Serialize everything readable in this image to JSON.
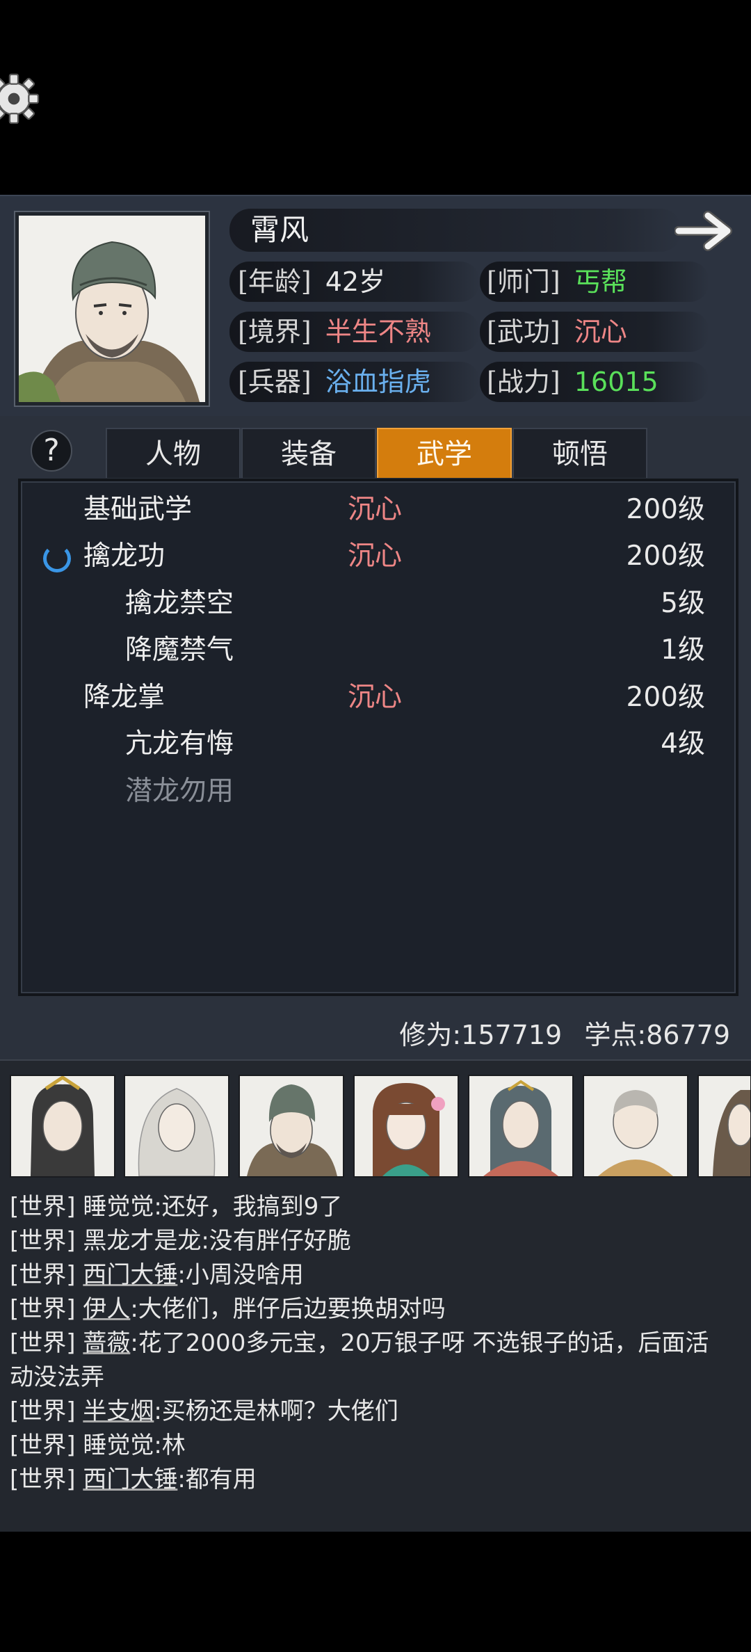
{
  "profile": {
    "name": "霄风",
    "age_label": "[年龄]",
    "age": "42岁",
    "sect_label": "[师门]",
    "sect": "丐帮",
    "realm_label": "[境界]",
    "realm": "半生不熟",
    "martial_label": "[武功]",
    "martial": "沉心",
    "weapon_label": "[兵器]",
    "weapon": "浴血指虎",
    "power_label": "[战力]",
    "power": "16015"
  },
  "help": "?",
  "tabs": [
    {
      "label": "人物",
      "active": false
    },
    {
      "label": "装备",
      "active": false
    },
    {
      "label": "武学",
      "active": true
    },
    {
      "label": "顿悟",
      "active": false
    }
  ],
  "skills": [
    {
      "name": "基础武学",
      "state": "沉心",
      "level": "200级"
    },
    {
      "name": "擒龙功",
      "state": "沉心",
      "level": "200级"
    },
    {
      "name": "擒龙禁空",
      "state": "",
      "level": "5级"
    },
    {
      "name": "降魔禁气",
      "state": "",
      "level": "1级"
    },
    {
      "name": "降龙掌",
      "state": "沉心",
      "level": "200级"
    },
    {
      "name": "亢龙有悔",
      "state": "",
      "level": "4级"
    },
    {
      "name": "潜龙勿用",
      "state": "",
      "level": ""
    }
  ],
  "footer": {
    "cultivation": "修为:157719",
    "points": "学点:86779"
  },
  "chat": [
    {
      "channel": "[世界]",
      "user": "睡觉觉",
      "text": ":还好，我搞到9了"
    },
    {
      "channel": "[世界]",
      "user": "黑龙才是龙",
      "text": ":没有胖仔好脆"
    },
    {
      "channel": "[世界]",
      "user": "西门大锤",
      "text": ":小周没啥用"
    },
    {
      "channel": "[世界]",
      "user": "伊人",
      "text": ":大佬们，胖仔后边要换胡对吗"
    },
    {
      "channel": "[世界]",
      "user": "蔷薇",
      "text": ":花了2000多元宝，20万银子呀 不选银子的话，后面活"
    },
    {
      "channel": "",
      "user": "",
      "text": "动没法弄"
    },
    {
      "channel": "[世界]",
      "user": "半支烟",
      "text": ":买杨还是林啊？大佬们"
    },
    {
      "channel": "[世界]",
      "user": "睡觉觉",
      "text": ":林"
    },
    {
      "channel": "[世界]",
      "user": "西门大锤",
      "text": ":都有用"
    }
  ],
  "colors": {
    "tab_active": "#d47d0d",
    "red": "#ee8686",
    "green": "#5ae05a",
    "blue": "#6ab0ee"
  }
}
